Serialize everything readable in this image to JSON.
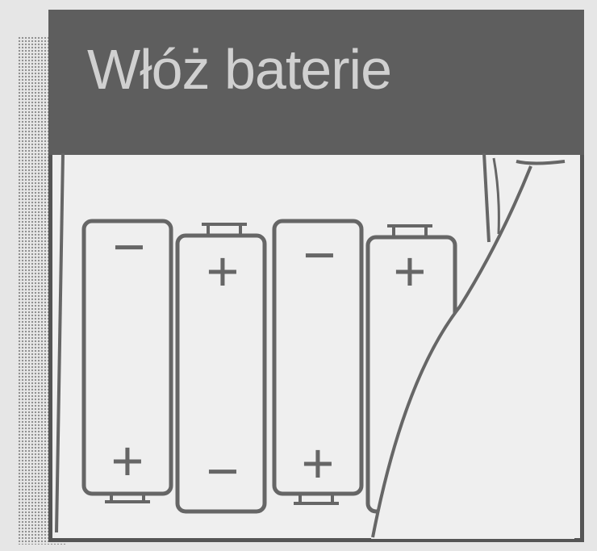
{
  "title": "Włóż baterie",
  "colors": {
    "header_bg": "#5e5e5e",
    "title_text": "#d0d0d0",
    "line": "#666666",
    "panel_bg": "#efefef"
  },
  "batteries": [
    {
      "top_symbol": "−",
      "bottom_symbol": "+"
    },
    {
      "top_symbol": "+",
      "bottom_symbol": "−"
    },
    {
      "top_symbol": "−",
      "bottom_symbol": "+"
    },
    {
      "top_symbol": "+",
      "bottom_symbol": ""
    }
  ]
}
